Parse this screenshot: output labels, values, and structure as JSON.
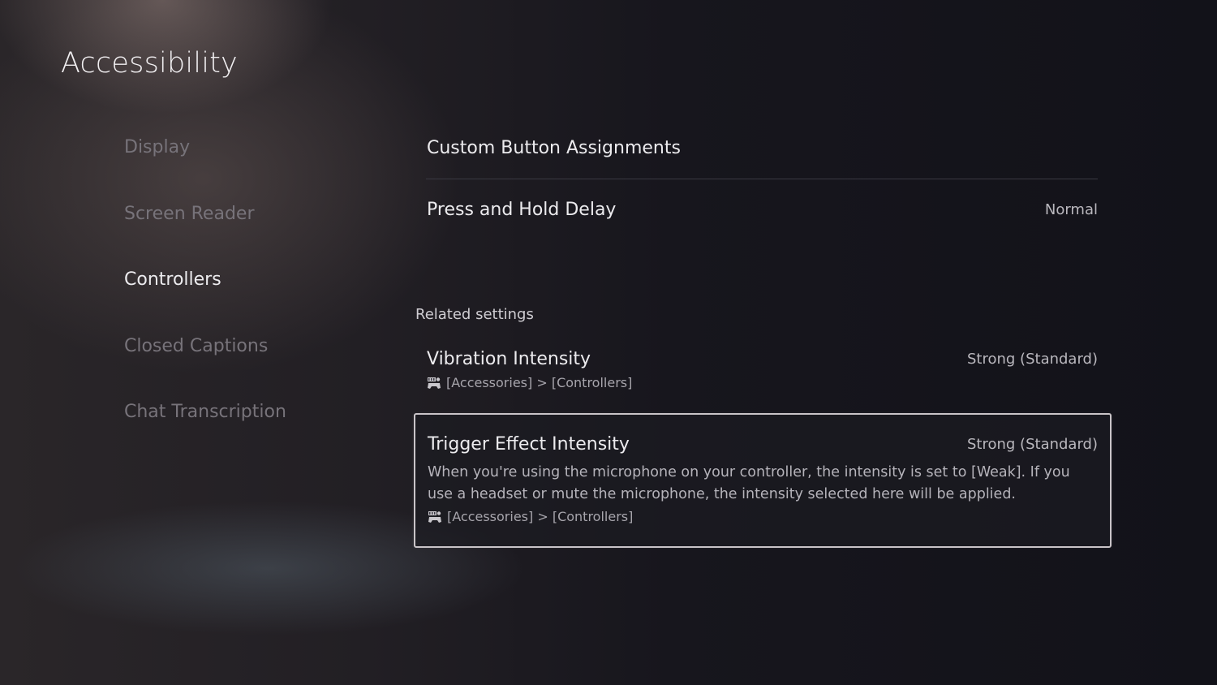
{
  "header": {
    "title": "Accessibility"
  },
  "sidebar": {
    "items": [
      {
        "label": "Display",
        "active": false
      },
      {
        "label": "Screen Reader",
        "active": false
      },
      {
        "label": "Controllers",
        "active": true
      },
      {
        "label": "Closed Captions",
        "active": false
      },
      {
        "label": "Chat Transcription",
        "active": false
      }
    ]
  },
  "main": {
    "settings": [
      {
        "label": "Custom Button Assignments"
      },
      {
        "label": "Press and Hold Delay",
        "value": "Normal"
      }
    ],
    "related_label": "Related settings",
    "related": [
      {
        "label": "Vibration Intensity",
        "value": "Strong (Standard)",
        "icon": "controller-settings-icon",
        "path": "[Accessories] > [Controllers]"
      },
      {
        "label": "Trigger Effect Intensity",
        "value": "Strong (Standard)",
        "description": "When you're using the microphone on your controller, the intensity is set to [Weak]. If you use a headset or mute the microphone, the intensity selected here will be applied.",
        "icon": "controller-settings-icon",
        "path": "[Accessories] > [Controllers]",
        "focused": true
      }
    ]
  }
}
